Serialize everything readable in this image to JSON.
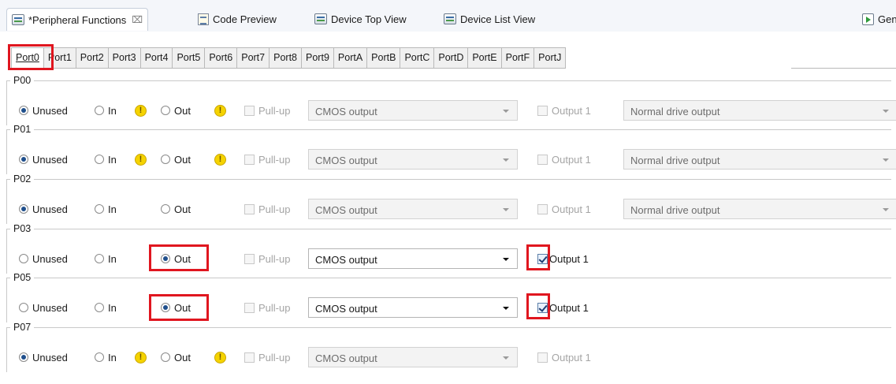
{
  "editor_tabs": [
    {
      "label": "*Peripheral Functions",
      "icon": "peripheral-functions-icon",
      "active": true,
      "close": "⌧"
    },
    {
      "label": "Code Preview",
      "icon": "code-preview-icon"
    },
    {
      "label": "Device Top View",
      "icon": "device-top-view-icon"
    },
    {
      "label": "Device List View",
      "icon": "device-list-view-icon"
    },
    {
      "label": "Gen",
      "icon": "generate-code-icon"
    }
  ],
  "port_tabs": [
    "Port0",
    "Port1",
    "Port2",
    "Port3",
    "Port4",
    "Port5",
    "Port6",
    "Port7",
    "Port8",
    "Port9",
    "PortA",
    "PortB",
    "PortC",
    "PortD",
    "PortE",
    "PortF",
    "PortJ"
  ],
  "active_port_tab": "Port0",
  "labels": {
    "unused": "Unused",
    "in": "In",
    "out": "Out",
    "pullup": "Pull-up",
    "output1": "Output 1",
    "warning": "!"
  },
  "pins": [
    {
      "name": "P00",
      "mode": "Unused",
      "in_warning": true,
      "out_warning": true,
      "output_type": "CMOS output",
      "output_enabled": false,
      "output1_checked": false,
      "output1_enabled": false,
      "drive": "Normal drive output"
    },
    {
      "name": "P01",
      "mode": "Unused",
      "in_warning": true,
      "out_warning": true,
      "output_type": "CMOS output",
      "output_enabled": false,
      "output1_checked": false,
      "output1_enabled": false,
      "drive": "Normal drive output"
    },
    {
      "name": "P02",
      "mode": "Unused",
      "in_warning": false,
      "out_warning": false,
      "output_type": "CMOS output",
      "output_enabled": false,
      "output1_checked": false,
      "output1_enabled": false,
      "drive": "Normal drive output"
    },
    {
      "name": "P03",
      "mode": "Out",
      "in_warning": false,
      "out_warning": false,
      "output_type": "CMOS output",
      "output_enabled": true,
      "output1_checked": true,
      "output1_enabled": true,
      "drive": ""
    },
    {
      "name": "P05",
      "mode": "Out",
      "in_warning": false,
      "out_warning": false,
      "output_type": "CMOS output",
      "output_enabled": true,
      "output1_checked": true,
      "output1_enabled": true,
      "drive": ""
    },
    {
      "name": "P07",
      "mode": "Unused",
      "in_warning": true,
      "out_warning": true,
      "output_type": "CMOS output",
      "output_enabled": false,
      "output1_checked": false,
      "output1_enabled": false,
      "drive": ""
    }
  ],
  "colors": {
    "highlight": "#e0161f",
    "radio_checked": "#1f4f8c",
    "warning": "#f5d300"
  }
}
